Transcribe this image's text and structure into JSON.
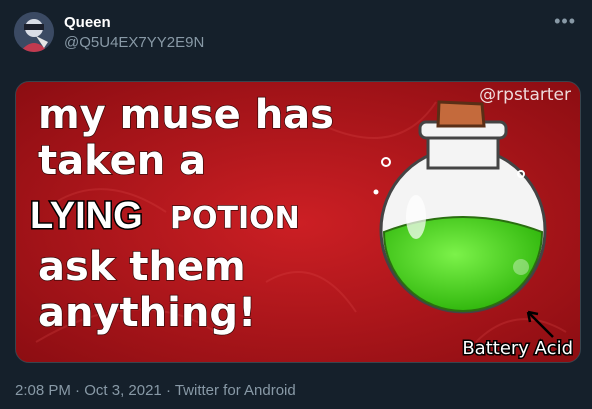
{
  "user": {
    "display_name": "Queen",
    "handle": "@Q5U4EX7YY2E9N"
  },
  "more_icon": "more-horizontal-icon",
  "media": {
    "watermark": "@rpstarter",
    "caption_lines": [
      "my muse has",
      "taken a"
    ],
    "caption_line_lying": "LYING",
    "caption_line_potion": "POTION",
    "caption_lines_after": [
      "ask them",
      "anything!"
    ],
    "annotation": "Battery Acid",
    "colors": {
      "background": "#b5141a",
      "potion_liquid": "#4cd91e",
      "cork": "#c46a3c"
    }
  },
  "meta": {
    "time": "2:08 PM",
    "separator": " · ",
    "date": "Oct 3, 2021",
    "source": "Twitter for Android"
  }
}
